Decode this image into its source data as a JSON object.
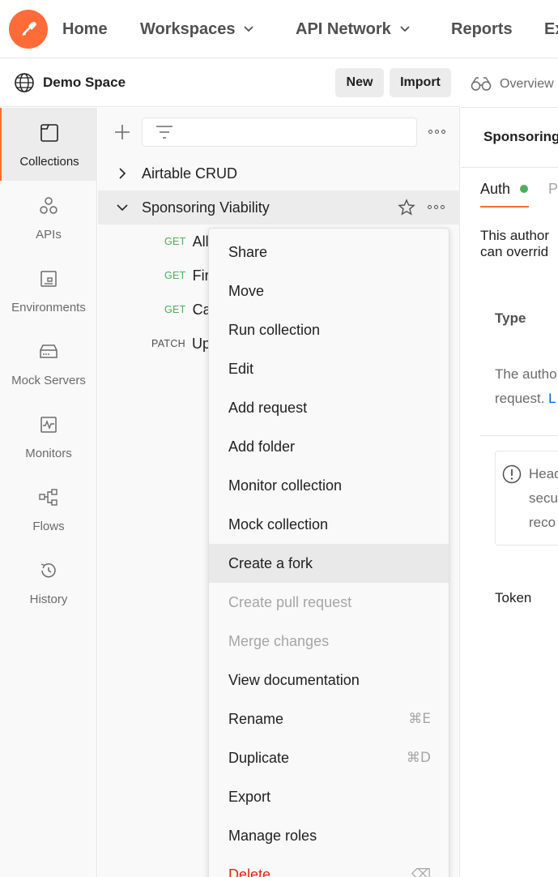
{
  "nav": {
    "home": "Home",
    "workspaces": "Workspaces",
    "api_network": "API Network",
    "reports": "Reports",
    "explore": "Explore"
  },
  "workspace": {
    "name": "Demo Space",
    "new_label": "New",
    "import_label": "Import"
  },
  "sidebar": {
    "items": [
      {
        "label": "Collections",
        "icon": "collections-icon",
        "active": true
      },
      {
        "label": "APIs",
        "icon": "apis-icon"
      },
      {
        "label": "Environments",
        "icon": "environments-icon"
      },
      {
        "label": "Mock Servers",
        "icon": "mock-servers-icon"
      },
      {
        "label": "Monitors",
        "icon": "monitors-icon"
      },
      {
        "label": "Flows",
        "icon": "flows-icon"
      },
      {
        "label": "History",
        "icon": "history-icon"
      }
    ]
  },
  "tree": {
    "collections": [
      {
        "name": "Airtable CRUD",
        "expanded": false
      },
      {
        "name": "Sponsoring Viability",
        "expanded": true,
        "selected": true
      }
    ],
    "requests": [
      {
        "method": "GET",
        "name": "All"
      },
      {
        "method": "GET",
        "name": "Fir"
      },
      {
        "method": "GET",
        "name": "Ca"
      },
      {
        "method": "PATCH",
        "name": "Up"
      }
    ]
  },
  "right": {
    "overview_tab": "Overview",
    "request_title": "Sponsoring",
    "auth_tab": "Auth",
    "p_tab": "P",
    "desc_line1": "This author",
    "desc_line2": "can overrid",
    "type_label": "Type",
    "info_line1": "The autho",
    "info_line2": "request.",
    "info_link": "L",
    "warn_line1": "Head",
    "warn_line2": "secu",
    "warn_line3": "reco",
    "token_label": "Token"
  },
  "menu": {
    "items": [
      {
        "label": "Share"
      },
      {
        "label": "Move"
      },
      {
        "label": "Run collection"
      },
      {
        "label": "Edit"
      },
      {
        "label": "Add request"
      },
      {
        "label": "Add folder"
      },
      {
        "label": "Monitor collection"
      },
      {
        "label": "Mock collection"
      },
      {
        "label": "Create a fork",
        "highlighted": true
      },
      {
        "label": "Create pull request",
        "disabled": true
      },
      {
        "label": "Merge changes",
        "disabled": true
      },
      {
        "label": "View documentation"
      },
      {
        "label": "Rename",
        "shortcut": "⌘E"
      },
      {
        "label": "Duplicate",
        "shortcut": "⌘D"
      },
      {
        "label": "Export"
      },
      {
        "label": "Manage roles"
      },
      {
        "label": "Delete",
        "shortcut": "⌫",
        "danger": true
      }
    ]
  },
  "colors": {
    "brand": "#ff6c37",
    "get_method": "#4fae5b",
    "auth_dot": "#4fae5b",
    "danger": "#eb2013",
    "link": "#0265d2"
  }
}
